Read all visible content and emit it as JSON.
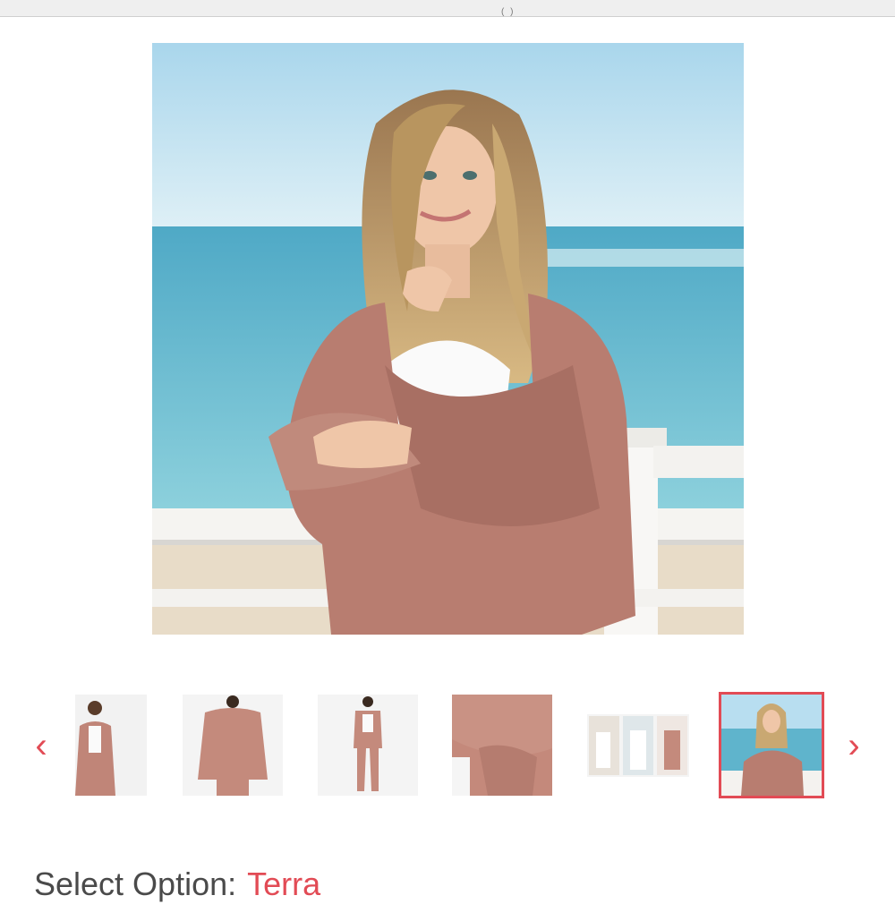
{
  "header": {
    "cut_text": "(  )"
  },
  "gallery": {
    "main_image_alt": "Model wearing Terra wrap cardigan by the ocean",
    "prev_icon": "chevron-left-icon",
    "next_icon": "chevron-right-icon",
    "thumbnails": [
      {
        "alt": "Front view full outfit"
      },
      {
        "alt": "Back view"
      },
      {
        "alt": "Full length with pants"
      },
      {
        "alt": "Fabric pocket detail"
      },
      {
        "alt": "Collage of looks"
      },
      {
        "alt": "Beach lifestyle shot",
        "selected": true
      }
    ]
  },
  "option": {
    "label": "Select Option:",
    "value": "Terra"
  },
  "colors": {
    "accent": "#e24b55",
    "sweater": "#b87d70",
    "sky": "#bfe0ee",
    "sea": "#5fb4cc"
  }
}
